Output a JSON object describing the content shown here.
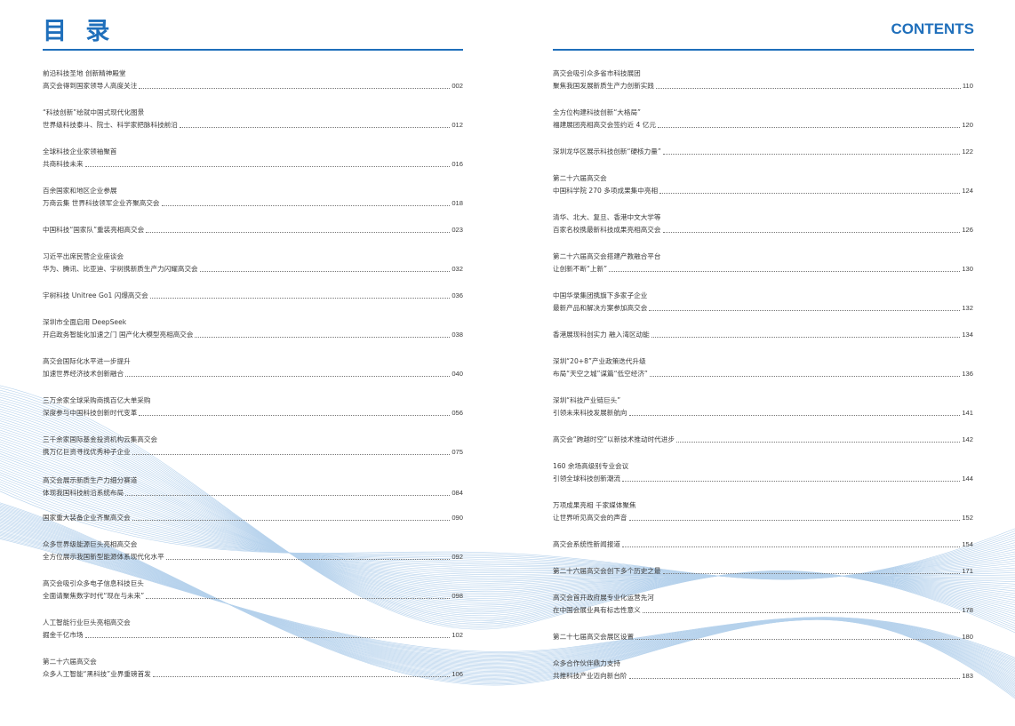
{
  "header": {
    "title_cn": "目 录",
    "title_en": "CONTENTS",
    "accent": "#1f6fbb"
  },
  "toc_left": [
    {
      "t1": "前沿科技圣地 创新精神殿堂",
      "t2": "高交会得到国家领导人高度关注",
      "page": "002"
    },
    {
      "t1": "“科技创新”绘就中国式现代化图景",
      "t2": "世界级科技泰斗、院士、科学家把脉科技前沿",
      "page": "012"
    },
    {
      "t1": "全球科技企业家领袖聚首",
      "t2": "共商科技未来",
      "page": "016"
    },
    {
      "t1": "百余国家和地区企业参展",
      "t2": "万商云集 世界科技领军企业齐聚高交会",
      "page": "018"
    },
    {
      "t1": "",
      "t2": "中国科技“国家队”重装亮相高交会",
      "page": "023"
    },
    {
      "t1": "习近平出席民营企业座谈会",
      "t2": "华为、腾讯、比亚迪、宇树携新质生产力闪耀高交会",
      "page": "032"
    },
    {
      "t1": "",
      "t2": "宇树科技 Unitree Go1 闪爆高交会",
      "page": "036"
    },
    {
      "t1": "深圳市全面启用 DeepSeek",
      "t2": "开启政务智能化加速之门 国产化大模型亮相高交会",
      "page": "038"
    },
    {
      "t1": "高交会国际化水平进一步提升",
      "t2": "加速世界经济技术创新融合",
      "page": "040"
    },
    {
      "t1": "三万余家全球采购商携百亿大单采购",
      "t2": "深度参与中国科技创新时代变革",
      "page": "056"
    },
    {
      "t1": "三千余家国际基金投资机构云集高交会",
      "t2": "携万亿巨资寻找优秀种子企业",
      "page": "075"
    },
    {
      "t1": "高交会展示新质生产力细分赛道",
      "t2": "体现我国科技前沿系统布局",
      "page": "084"
    },
    {
      "t1": "",
      "t2": "国家重大装备企业齐聚高交会",
      "page": "090"
    },
    {
      "t1": "众多世界级能源巨头亮相高交会",
      "t2": "全方位展示我国新型能源体系现代化水平",
      "page": "092"
    },
    {
      "t1": "高交会吸引众多电子信息科技巨头",
      "t2": "全面请聚焦数字时代“现在与未来”",
      "page": "098"
    },
    {
      "t1": "人工智能行业巨头亮相高交会",
      "t2": "掘金千亿市场",
      "page": "102"
    },
    {
      "t1": "第二十六届高交会",
      "t2": "众多人工智能“黑科技”业界重磅首发",
      "page": "106"
    }
  ],
  "toc_right": [
    {
      "t1": "高交会吸引众多省市科技展团",
      "t2": "聚焦我国发展新质生产力创新实践",
      "page": "110"
    },
    {
      "t1": "全方位构建科技创新“大格局”",
      "t2": "福建展团亮相高交会签约近 4 亿元",
      "page": "120"
    },
    {
      "t1": "",
      "t2": "深圳龙华区展示科技创新“硬核力量”",
      "page": "122"
    },
    {
      "t1": "第二十六届高交会",
      "t2": "中国科学院 270 多项成果集中亮相",
      "page": "124"
    },
    {
      "t1": "清华、北大、复旦、香港中文大学等",
      "t2": "百家名校携最新科技成果亮相高交会",
      "page": "126"
    },
    {
      "t1": "第二十六届高交会搭建产教融合平台",
      "t2": "让创新不断“上新”",
      "page": "130"
    },
    {
      "t1": "中国华录集团携旗下多家子企业",
      "t2": "最新产品和解决方案参加高交会",
      "page": "132"
    },
    {
      "t1": "",
      "t2": "香港展现科创实力 融入湾区动能",
      "page": "134"
    },
    {
      "t1": "深圳“20+8”产业政策迭代升级",
      "t2": "布局“天空之城”谋篇“低空经济”",
      "page": "136"
    },
    {
      "t1": "深圳“科技产业链巨头”",
      "t2": "引领未来科技发展新航向",
      "page": "141"
    },
    {
      "t1": "",
      "t2": "高交会“跨越时空”以新技术推动时代进步",
      "page": "142"
    },
    {
      "t1": "160 余场高级别专业会议",
      "t2": "引领全球科技创新潮流",
      "page": "144"
    },
    {
      "t1": "万项成果亮相 千家媒体聚焦",
      "t2": "让世界听见高交会的声音",
      "page": "152"
    },
    {
      "t1": "",
      "t2": "高交会系统性新闻报道",
      "page": "154"
    },
    {
      "t1": "",
      "t2": "第二十六届高交会创下多个历史之最",
      "page": "171"
    },
    {
      "t1": "高交会首开政府展专业化运营先河",
      "t2": "在中国会展业具有标志性意义",
      "page": "178"
    },
    {
      "t1": "",
      "t2": "第二十七届高交会展区设置",
      "page": "180"
    },
    {
      "t1": "众多合作伙伴鼎力支持",
      "t2": "共推科技产业迈向新台阶",
      "page": "183"
    }
  ]
}
